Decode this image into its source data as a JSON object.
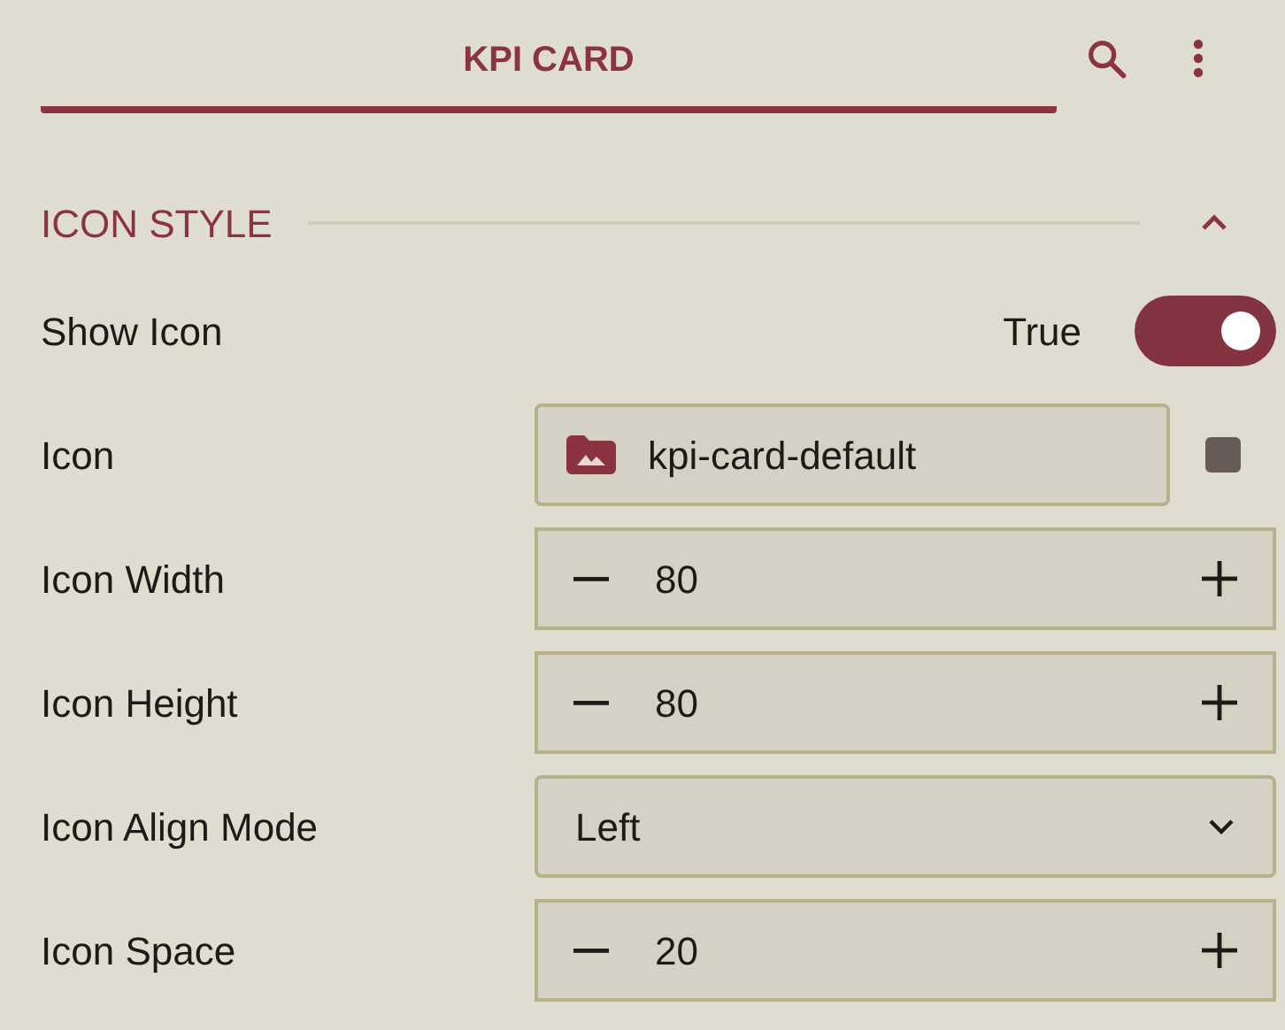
{
  "tabs": [
    {
      "label": "KPI CARD",
      "selected": true
    }
  ],
  "section": {
    "title": "ICON STYLE",
    "expanded": true
  },
  "rows": [
    {
      "kind": "toggle",
      "label": "Show Icon",
      "value": "True",
      "on": true
    },
    {
      "kind": "file",
      "label": "Icon",
      "value": "kpi-card-default",
      "color": "#675b55"
    },
    {
      "kind": "number",
      "label": "Icon Width",
      "value": "80"
    },
    {
      "kind": "number",
      "label": "Icon Height",
      "value": "80"
    },
    {
      "kind": "select",
      "label": "Icon Align Mode",
      "value": "Left"
    },
    {
      "kind": "number",
      "label": "Icon Space",
      "value": "20"
    }
  ]
}
